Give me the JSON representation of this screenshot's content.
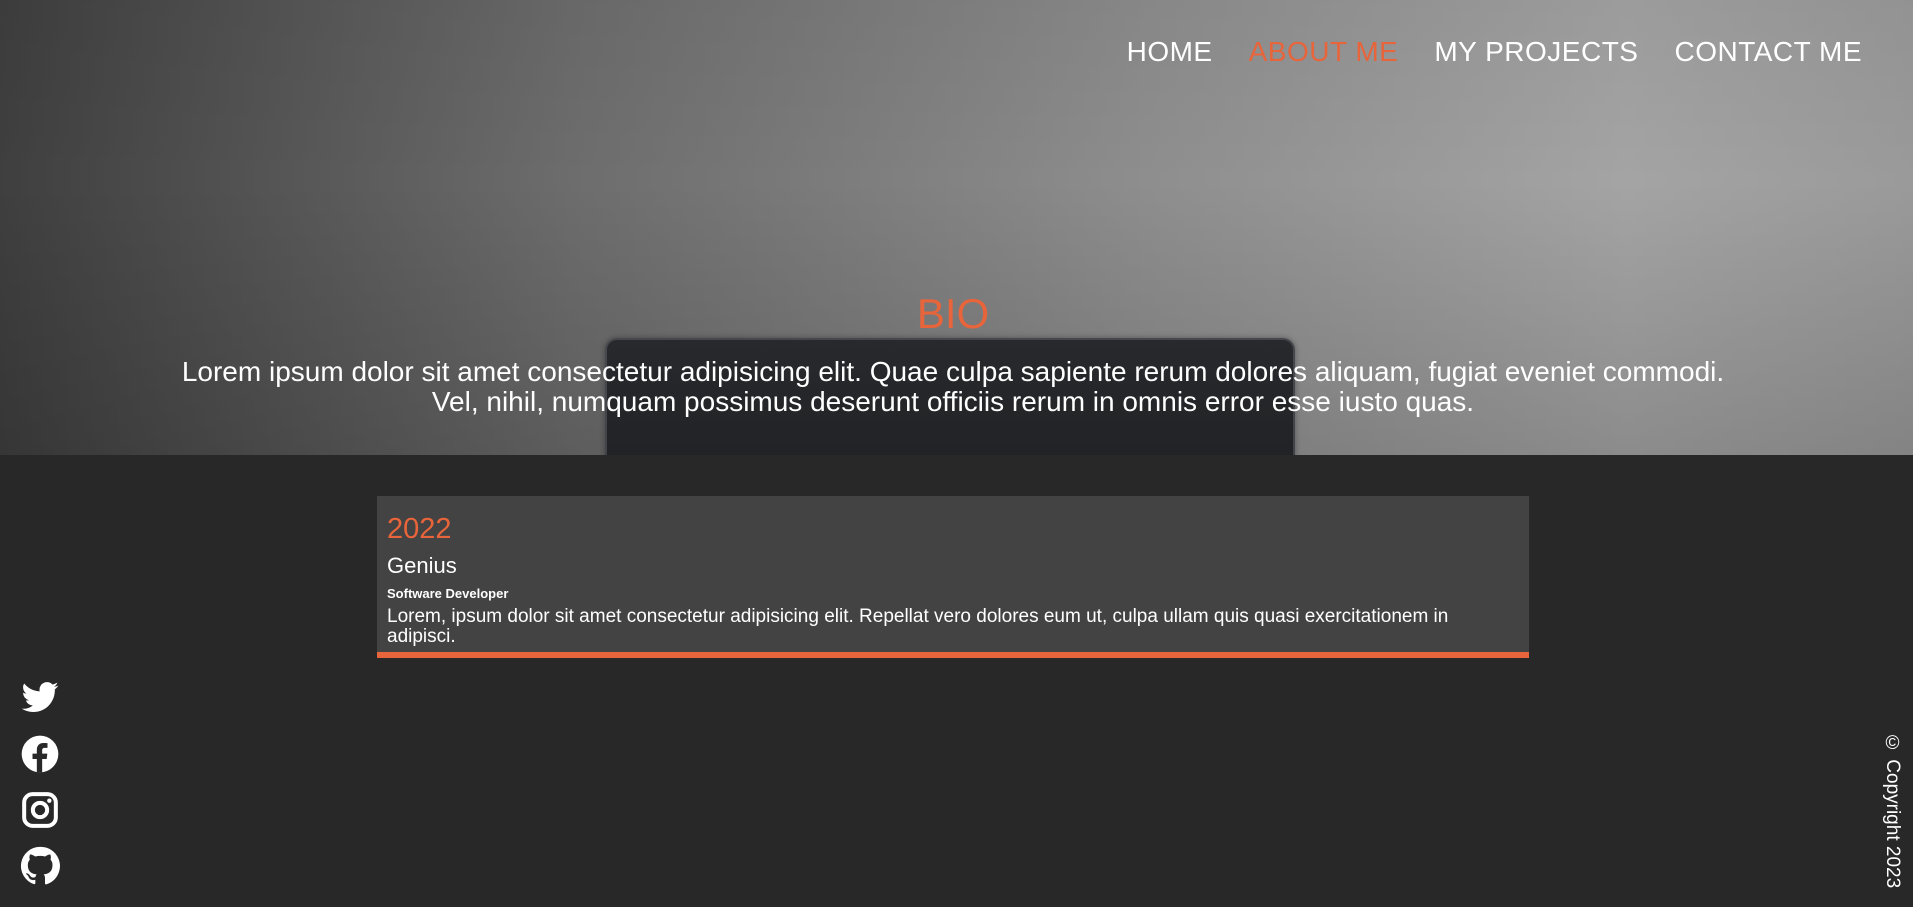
{
  "nav": {
    "items": [
      {
        "label": "HOME",
        "active": false
      },
      {
        "label": "ABOUT ME",
        "active": true
      },
      {
        "label": "MY PROJECTS",
        "active": false
      },
      {
        "label": "CONTACT ME",
        "active": false
      }
    ]
  },
  "hero": {
    "title": "BIO",
    "text": "Lorem ipsum dolor sit amet consectetur adipisicing elit. Quae culpa sapiente rerum dolores aliquam, fugiat eveniet commodi. Vel, nihil, numquam possimus deserunt officiis rerum in omnis error esse iusto quas."
  },
  "timeline": [
    {
      "year": "2022",
      "company": "Genius",
      "role": "Software Developer",
      "description": "Lorem, ipsum dolor sit amet consectetur adipisicing elit. Repellat vero dolores eum ut, culpa ullam quis quasi exercitationem in adipisci."
    }
  ],
  "social": {
    "icons": [
      "twitter-icon",
      "facebook-icon",
      "instagram-icon",
      "github-icon"
    ]
  },
  "footer": {
    "copyright": "© Copyright 2023"
  },
  "colors": {
    "accent": "#e8643a",
    "background": "#282828",
    "card": "#434343"
  }
}
